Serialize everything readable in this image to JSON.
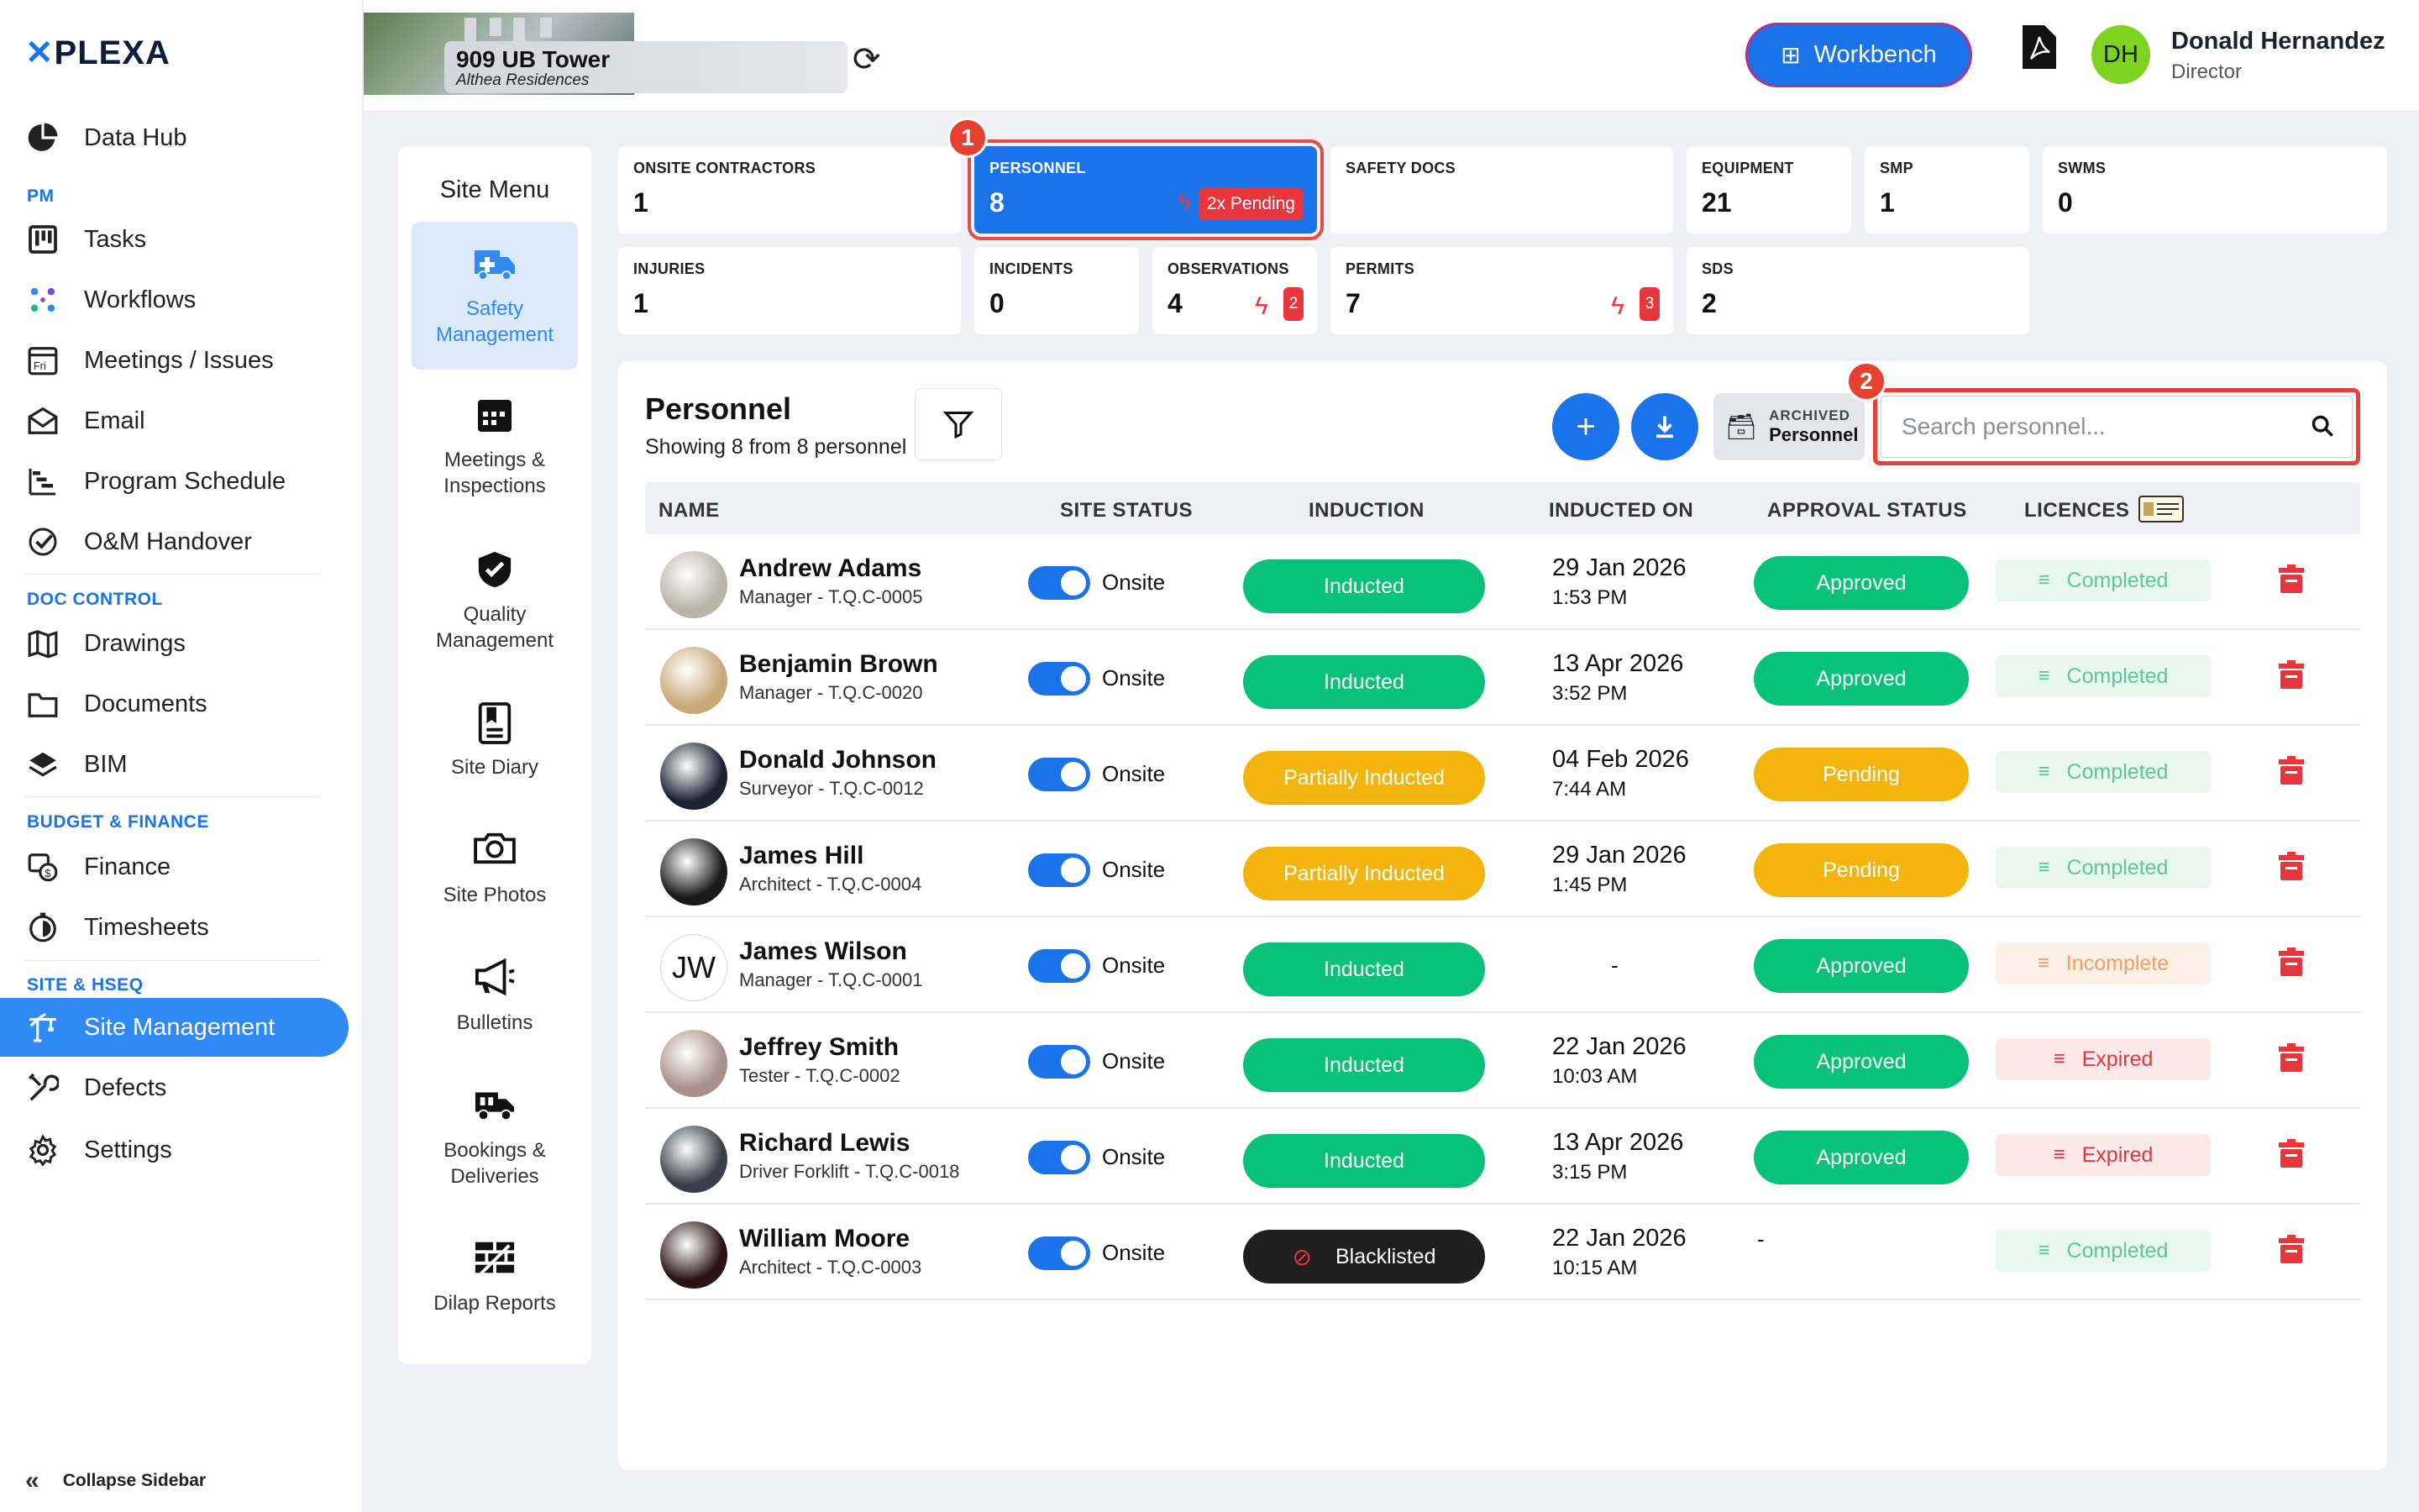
{
  "brand": {
    "logo": "PLEXA"
  },
  "sidebar": {
    "items": [
      {
        "label": "Data Hub",
        "icon": "pie-chart-icon"
      },
      {
        "label": "Tasks",
        "icon": "kanban-icon"
      },
      {
        "label": "Workflows",
        "icon": "workflow-icon"
      },
      {
        "label": "Meetings / Issues",
        "icon": "calendar-icon"
      },
      {
        "label": "Email",
        "icon": "envelope-icon"
      },
      {
        "label": "Program Schedule",
        "icon": "gantt-icon"
      },
      {
        "label": "O&M Handover",
        "icon": "check-circle-icon"
      },
      {
        "label": "Drawings",
        "icon": "map-icon"
      },
      {
        "label": "Documents",
        "icon": "folder-icon"
      },
      {
        "label": "BIM",
        "icon": "layers-icon"
      },
      {
        "label": "Finance",
        "icon": "finance-icon"
      },
      {
        "label": "Timesheets",
        "icon": "stopwatch-icon"
      },
      {
        "label": "Site Management",
        "icon": "crane-icon"
      },
      {
        "label": "Defects",
        "icon": "tools-icon"
      },
      {
        "label": "Settings",
        "icon": "gear-icon"
      }
    ],
    "sections": [
      "PM",
      "DOC CONTROL",
      "BUDGET & FINANCE",
      "SITE & HSEQ"
    ],
    "collapse_label": "Collapse Sidebar"
  },
  "header": {
    "site_name": "909 UB Tower",
    "site_sub": "Althea Residences",
    "workbench_label": "Workbench",
    "user_initials": "DH",
    "user_name": "Donald Hernandez",
    "user_role": "Director"
  },
  "site_menu": {
    "title": "Site Menu",
    "items": [
      {
        "label": "Safety Management",
        "icon": "ambulance-icon",
        "active": true
      },
      {
        "label": "Meetings & Inspections",
        "icon": "calendar-grid-icon"
      },
      {
        "label": "Quality Management",
        "icon": "shield-check-icon"
      },
      {
        "label": "Site Diary",
        "icon": "notebook-icon"
      },
      {
        "label": "Site Photos",
        "icon": "camera-icon"
      },
      {
        "label": "Bulletins",
        "icon": "megaphone-icon"
      },
      {
        "label": "Bookings & Deliveries",
        "icon": "truck-icon"
      },
      {
        "label": "Dilap Reports",
        "icon": "brick-wall-icon"
      }
    ]
  },
  "stats": [
    {
      "label": "ONSITE CONTRACTORS",
      "value": "1"
    },
    {
      "label": "PERSONNEL",
      "value": "8",
      "pending": "2x Pending"
    },
    {
      "label": "SAFETY DOCS",
      "value": ""
    },
    {
      "label": "EQUIPMENT",
      "value": "21"
    },
    {
      "label": "SMP",
      "value": "1"
    },
    {
      "label": "SWMS",
      "value": "0"
    },
    {
      "label": "INJURIES",
      "value": "1"
    },
    {
      "label": "INCIDENTS",
      "value": "0"
    },
    {
      "label": "OBSERVATIONS",
      "value": "4",
      "badge": "2"
    },
    {
      "label": "PERMITS",
      "value": "7",
      "badge": "3"
    },
    {
      "label": "SDS",
      "value": "2"
    }
  ],
  "markers": [
    "1",
    "2"
  ],
  "personnel": {
    "title": "Personnel",
    "subtitle": "Showing 8 from 8 personnel",
    "archived_top": "ARCHIVED",
    "archived_bottom": "Personnel",
    "search_placeholder": "Search personnel...",
    "columns": [
      "NAME",
      "SITE STATUS",
      "INDUCTION",
      "INDUCTED ON",
      "APPROVAL STATUS",
      "LICENCES"
    ],
    "rows": [
      {
        "name": "Andrew Adams",
        "role": "Manager - T.Q.C-0005",
        "site": "Onsite",
        "induction": "Inducted",
        "ind_type": "green",
        "date": "29 Jan 2026",
        "time": "1:53 PM",
        "approval": "Approved",
        "appr_type": "green",
        "licence": "Completed",
        "lic_type": "complete",
        "avatar_color": "#b9b3a8"
      },
      {
        "name": "Benjamin Brown",
        "role": "Manager - T.Q.C-0020",
        "site": "Onsite",
        "induction": "Inducted",
        "ind_type": "green",
        "date": "13 Apr 2026",
        "time": "3:52 PM",
        "approval": "Approved",
        "appr_type": "green",
        "licence": "Completed",
        "lic_type": "complete",
        "avatar_color": "#c9a978"
      },
      {
        "name": "Donald Johnson",
        "role": "Surveyor - T.Q.C-0012",
        "site": "Onsite",
        "induction": "Partially Inducted",
        "ind_type": "yellow",
        "date": "04 Feb 2026",
        "time": "7:44 AM",
        "approval": "Pending",
        "appr_type": "yellow",
        "licence": "Completed",
        "lic_type": "complete",
        "avatar_color": "#1d2233"
      },
      {
        "name": "James Hill",
        "role": "Architect - T.Q.C-0004",
        "site": "Onsite",
        "induction": "Partially Inducted",
        "ind_type": "yellow",
        "date": "29 Jan 2026",
        "time": "1:45 PM",
        "approval": "Pending",
        "appr_type": "yellow",
        "licence": "Completed",
        "lic_type": "complete",
        "avatar_color": "#1a1a1a"
      },
      {
        "name": "James Wilson",
        "role": "Manager - T.Q.C-0001",
        "site": "Onsite",
        "induction": "Inducted",
        "ind_type": "green",
        "date": "-",
        "time": "",
        "approval": "Approved",
        "appr_type": "green",
        "licence": "Incomplete",
        "lic_type": "incomplete",
        "initials": "JW"
      },
      {
        "name": "Jeffrey Smith",
        "role": "Tester - T.Q.C-0002",
        "site": "Onsite",
        "induction": "Inducted",
        "ind_type": "green",
        "date": "22 Jan 2026",
        "time": "10:03 AM",
        "approval": "Approved",
        "appr_type": "green",
        "licence": "Expired",
        "lic_type": "expired",
        "avatar_color": "#a9908a"
      },
      {
        "name": "Richard Lewis",
        "role": "Driver Forklift - T.Q.C-0018",
        "site": "Onsite",
        "induction": "Inducted",
        "ind_type": "green",
        "date": "13 Apr 2026",
        "time": "3:15 PM",
        "approval": "Approved",
        "appr_type": "green",
        "licence": "Expired",
        "lic_type": "expired",
        "avatar_color": "#3b3e4a"
      },
      {
        "name": "William Moore",
        "role": "Architect - T.Q.C-0003",
        "site": "Onsite",
        "induction": "Blacklisted",
        "ind_type": "black",
        "date": "22 Jan 2026",
        "time": "10:15 AM",
        "approval": "-",
        "appr_type": "none",
        "licence": "Completed",
        "lic_type": "complete",
        "avatar_color": "#2a1216"
      }
    ]
  }
}
